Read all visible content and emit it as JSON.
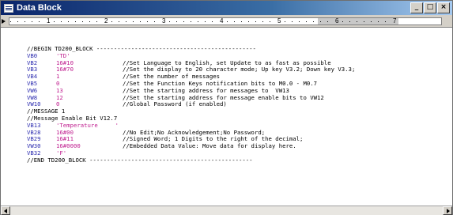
{
  "window": {
    "title": "Data Block",
    "controls": {
      "minimize": "_",
      "maximize": "□",
      "close": "×"
    }
  },
  "ruler": {
    "numbers": [
      "1",
      "2",
      "3",
      "4",
      "5",
      "6",
      "7"
    ]
  },
  "editor": {
    "lines": [
      {
        "type": "plain",
        "text": "//BEGIN TD200_BLOCK ----------------------------------------------"
      },
      {
        "type": "entry",
        "addr": "VB0",
        "value": "'TD'",
        "comment": ""
      },
      {
        "type": "entry",
        "addr": "VB2",
        "value": "16#10",
        "comment": "//Set Language to English, set Update to as fast as possible"
      },
      {
        "type": "entry",
        "addr": "VB3",
        "value": "16#70",
        "comment": "//Set the display to 20 character mode; Up key V3.2; Down key V3.3;"
      },
      {
        "type": "entry",
        "addr": "VB4",
        "value": "1",
        "comment": "//Set the number of messages"
      },
      {
        "type": "entry",
        "addr": "VB5",
        "value": "0",
        "comment": "//Set the Function Keys notification bits to M0.0 - M0.7"
      },
      {
        "type": "entry",
        "addr": "VW6",
        "value": "13",
        "comment": "//Set the starting address for messages to  VW13"
      },
      {
        "type": "entry",
        "addr": "VW8",
        "value": "12",
        "comment": "//Set the starting address for message enable bits to VW12"
      },
      {
        "type": "entry",
        "addr": "VW10",
        "value": "0",
        "comment": "//Global Password (if enabled)"
      },
      {
        "type": "plain",
        "text": "//MESSAGE 1"
      },
      {
        "type": "plain",
        "text": "//Message Enable Bit V12.7"
      },
      {
        "type": "entry",
        "addr": "VB13",
        "value": "'Temperature     '",
        "comment": ""
      },
      {
        "type": "entry",
        "addr": "VB28",
        "value": "16#00",
        "comment": "//No Edit;No Acknowledgement;No Password;"
      },
      {
        "type": "entry",
        "addr": "VB29",
        "value": "16#11",
        "comment": "//Signed Word; 1 Digits to the right of the decimal;"
      },
      {
        "type": "entry",
        "addr": "VW30",
        "value": "16#0000",
        "comment": "//Embedded Data Value: Move data for display here."
      },
      {
        "type": "entry",
        "addr": "VB32",
        "value": "'F'",
        "comment": ""
      },
      {
        "type": "plain",
        "text": "//END TD200_BLOCK -----------------------------------------------"
      }
    ]
  },
  "colors": {
    "title_bar": "#0a246a",
    "address": "#2e2eb0",
    "value": "#c02090",
    "comment": "#000000"
  },
  "icons": {
    "window": "data-block-icon",
    "scroll_left": "arrow-left-icon",
    "scroll_right": "arrow-right-icon"
  }
}
